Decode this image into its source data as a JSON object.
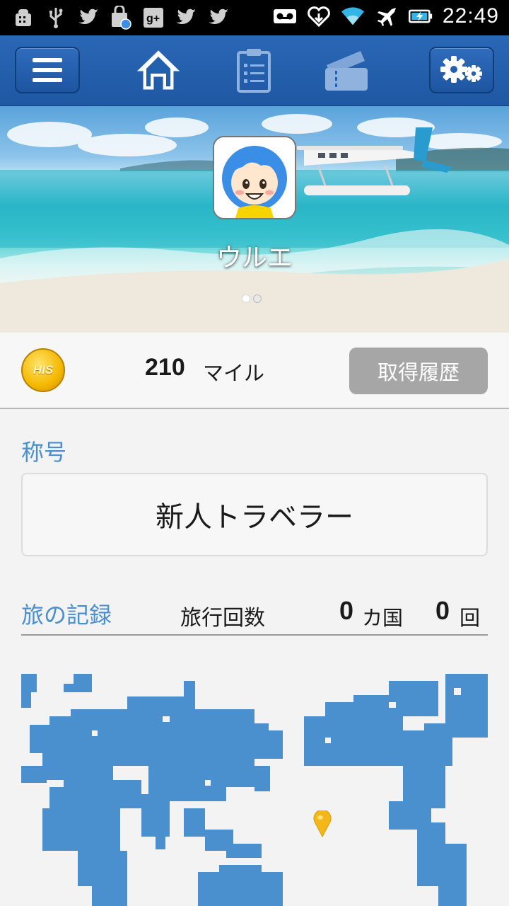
{
  "status_bar": {
    "time": "22:49",
    "left_icons": [
      "android-debug-icon",
      "usb-icon",
      "twitter-icon",
      "shopping-bag-icon",
      "google-plus-icon",
      "twitter-icon",
      "twitter-icon"
    ],
    "right_icons": [
      "voicemail-icon",
      "heart-download-icon",
      "wifi-icon",
      "airplane-mode-icon",
      "battery-charging-icon"
    ]
  },
  "nav": {
    "icons": [
      "menu-icon",
      "home-icon",
      "clipboard-icon",
      "ticket-icon",
      "settings-icon"
    ],
    "active": "home-icon"
  },
  "profile": {
    "name": "ウルエ",
    "carousel_pages": 2,
    "carousel_active": 1
  },
  "miles": {
    "coin_label": "HIS",
    "value": "210",
    "unit": "マイル",
    "history_button": "取得履歴"
  },
  "title_section": {
    "label": "称号",
    "value": "新人トラベラー"
  },
  "travel_record": {
    "label": "旅の記録",
    "count_label": "旅行回数",
    "countries_value": "0",
    "countries_unit": "カ国",
    "trips_value": "0",
    "trips_unit": "回"
  },
  "colors": {
    "navbar": "#2361ae",
    "accent_label": "#4a8fcf",
    "map": "#4a90cf",
    "pin": "#f3b71a",
    "history_button": "#a6a6a6"
  }
}
